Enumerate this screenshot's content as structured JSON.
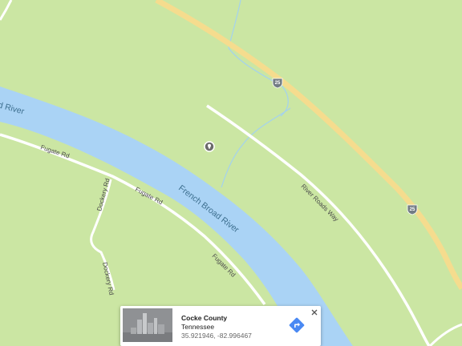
{
  "map": {
    "river_labels": {
      "main": "French Broad River",
      "edge": "d River"
    },
    "road_labels": {
      "fugate_1": "Fugate Rd",
      "fugate_2": "Fugate Rd",
      "fugate_3": "Fugate Rd",
      "dockery_1": "Dockery Rd",
      "dockery_2": "Dockery Rd",
      "river_roads": "River Roads Way"
    },
    "highway_shields": [
      "25",
      "25"
    ],
    "marker_icon": "place-marker-icon",
    "colors": {
      "land": "#cbe6a3",
      "water": "#aad3f5",
      "highway": "#f5dc8e",
      "road": "#ffffff",
      "stream": "#a4d2ee",
      "shield": "#737c84"
    }
  },
  "info_card": {
    "title": "Cocke County",
    "subtitle": "Tennessee",
    "coordinates": "35.921946, -82.996467",
    "directions_icon": "directions-icon",
    "close_icon": "close-icon",
    "thumbnail_icon": "street-view-thumbnail"
  }
}
